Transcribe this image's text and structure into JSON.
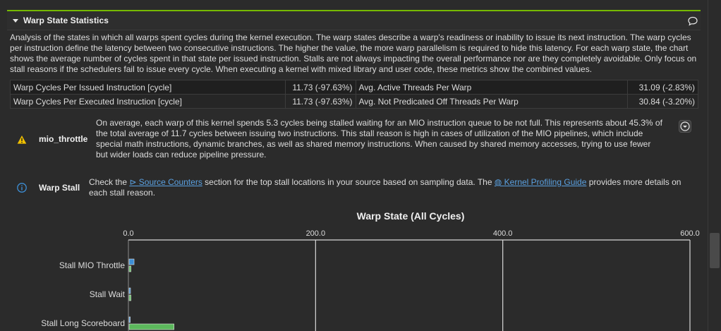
{
  "section": {
    "title": "Warp State Statistics",
    "description": "Analysis of the states in which all warps spent cycles during the kernel execution. The warp states describe a warp's readiness or inability to issue its next instruction. The warp cycles per instruction define the latency between two consecutive instructions. The higher the value, the more warp parallelism is required to hide this latency. For each warp state, the chart shows the average number of cycles spent in that state per issued instruction. Stalls are not always impacting the overall performance nor are they completely avoidable. Only focus on stall reasons if the schedulers fail to issue every cycle. When executing a kernel with mixed library and user code, these metrics show the combined values."
  },
  "metrics": [
    {
      "label": "Warp Cycles Per Issued Instruction [cycle]",
      "value": "11.73 (-97.63%)",
      "label2": "Avg. Active Threads Per Warp",
      "value2": "31.09 (-2.83%)"
    },
    {
      "label": "Warp Cycles Per Executed Instruction [cycle]",
      "value": "11.73 (-97.63%)",
      "label2": "Avg. Not Predicated Off Threads Per Warp",
      "value2": "30.84 (-3.20%)"
    }
  ],
  "rules": {
    "mio": {
      "name": "mio_throttle",
      "icon": "warning-icon",
      "lines": [
        "On average, each warp of this kernel spends 5.3 cycles being stalled waiting for an MIO instruction queue to be not full. This represents about 45.3% of",
        "the total average of 11.7 cycles between issuing two instructions. This stall reason is high in cases of utilization of the MIO pipelines, which include",
        "special math instructions, dynamic branches, as well as shared memory instructions. When caused by shared memory accesses, trying to use fewer",
        "but wider loads can reduce pipeline pressure."
      ]
    },
    "stall": {
      "name": "Warp Stall",
      "icon": "info-icon",
      "text_a": "Check the ",
      "link1": "Source Counters",
      "text_b": " section for the top stall locations in your source based on sampling data. The ",
      "link2": "Kernel Profiling Guide",
      "text_c": " provides more details on",
      "text_d": "each stall reason."
    }
  },
  "colors": {
    "accent": "#76b900",
    "current": "#3d8fd6",
    "baseline": "#5cb85c",
    "warning": "#f0c000",
    "info": "#3d8fd6"
  },
  "chart_data": {
    "type": "bar",
    "title": "Warp State (All Cycles)",
    "xlim": [
      0,
      600
    ],
    "ticks": [
      "0.0",
      "200.0",
      "400.0",
      "600.0"
    ],
    "tick_values": [
      0,
      200,
      400,
      600
    ],
    "categories": [
      "Stall MIO Throttle",
      "Stall Wait",
      "Stall Long Scoreboard"
    ],
    "series": [
      {
        "values": [
          5.3,
          1.5,
          1.2
        ]
      },
      {
        "values": [
          2.0,
          2.0,
          48.0
        ]
      }
    ]
  }
}
